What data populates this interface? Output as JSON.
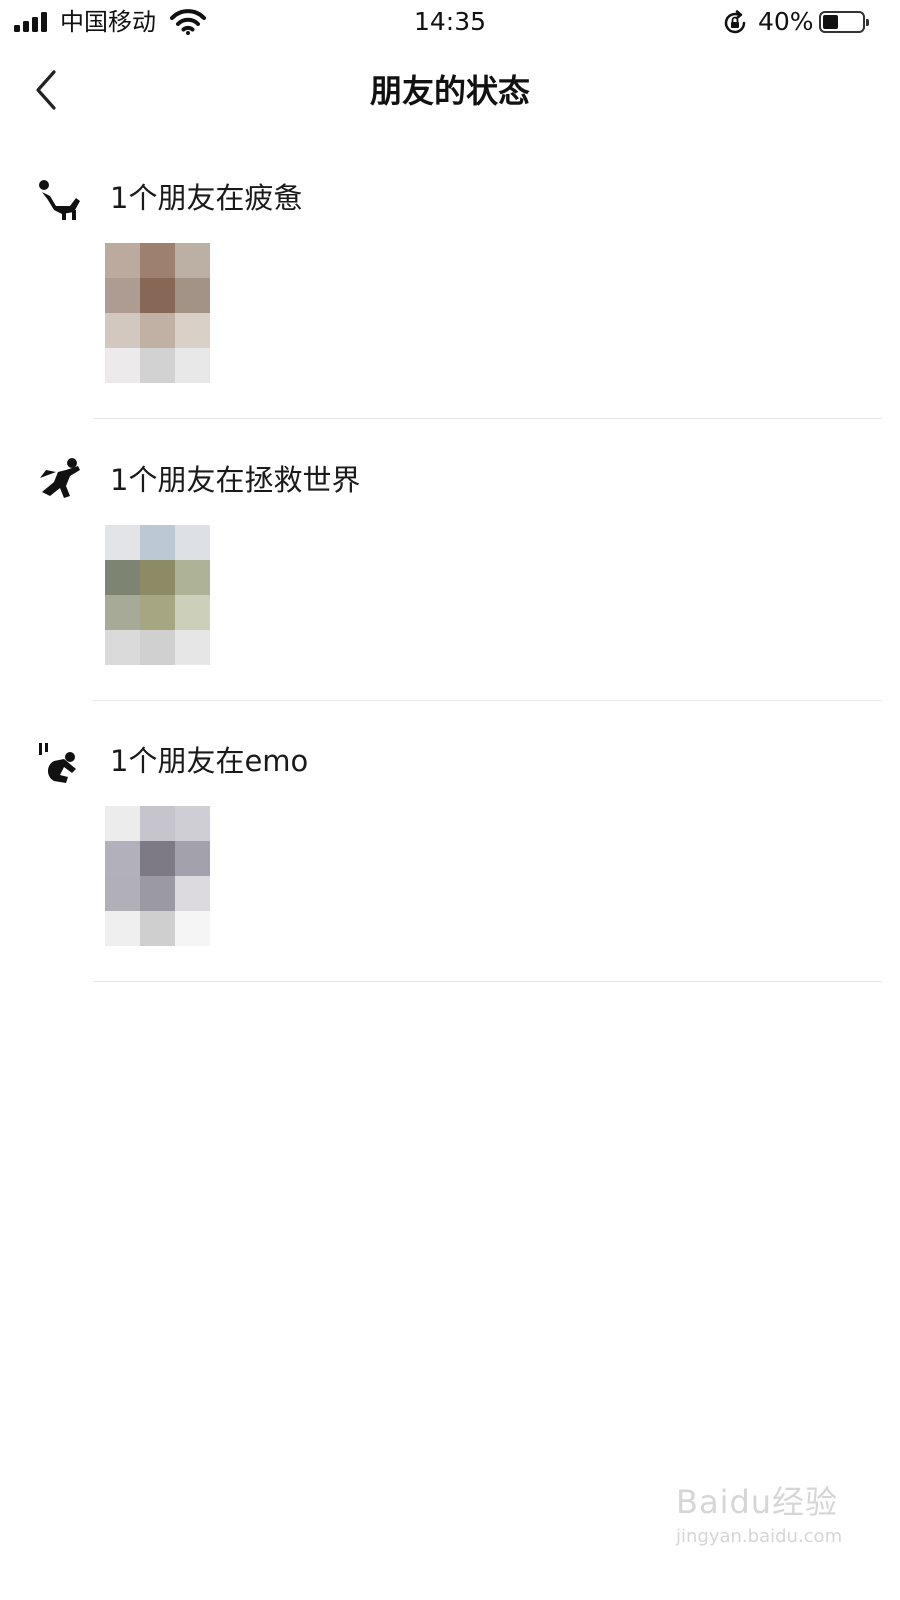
{
  "status_bar": {
    "carrier": "中国移动",
    "time": "14:35",
    "battery_percent": "40%",
    "battery_level": 0.4,
    "icons": [
      "signal-icon",
      "wifi-icon",
      "rotation-lock-icon",
      "battery-icon"
    ]
  },
  "nav": {
    "back_icon": "chevron-left-icon",
    "title": "朋友的状态"
  },
  "sections": [
    {
      "icon": "tired-person-icon",
      "title": "1个朋友在疲惫",
      "avatar": "blurred-avatar"
    },
    {
      "icon": "superhero-icon",
      "title": "1个朋友在拯救世界",
      "avatar": "blurred-avatar"
    },
    {
      "icon": "emo-person-icon",
      "title": "1个朋友在emo",
      "avatar": "blurred-avatar"
    }
  ],
  "watermark": {
    "logo": "Baidu经验",
    "url": "jingyan.baidu.com"
  },
  "colors": {
    "background": "#ffffff",
    "text": "#1a1a1a",
    "divider": "#e8e8e8",
    "watermark": "#d6d6d6"
  }
}
